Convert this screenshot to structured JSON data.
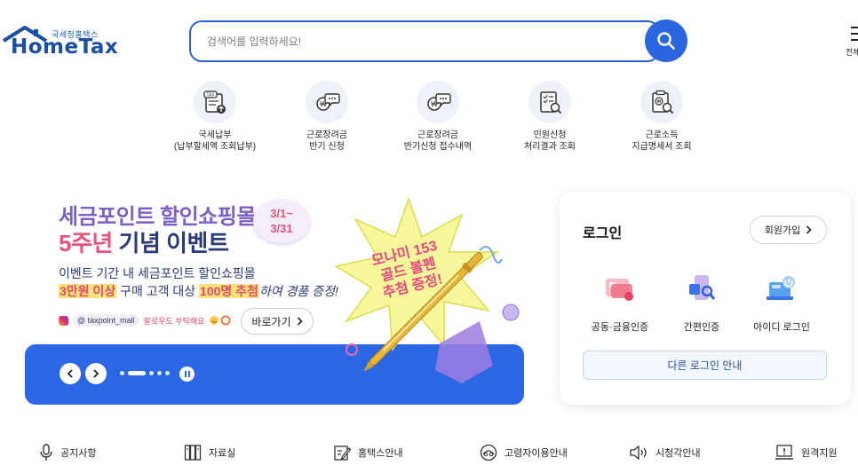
{
  "header": {
    "logo_kr": "국세청홈택스",
    "logo_en": "HomeTax",
    "search_placeholder": "검색어를 입력하세요!",
    "menu_all_label": "전체"
  },
  "quick_links": [
    {
      "line1": "국세납부",
      "line2": "(납부할세액 조회납부)",
      "icon": "tax-payment-icon"
    },
    {
      "line1": "근로장려금",
      "line2": "반기 신청",
      "icon": "incentive-apply-icon"
    },
    {
      "line1": "근로장려금",
      "line2": "반기신청 접수내역",
      "icon": "incentive-history-icon"
    },
    {
      "line1": "민원신청",
      "line2": "처리결과 조회",
      "icon": "civil-result-icon"
    },
    {
      "line1": "근로소득",
      "line2": "지급명세서 조회",
      "icon": "income-statement-icon"
    }
  ],
  "banner": {
    "title1": "세금포인트 할인쇼핑몰",
    "title2_pink": "5주년",
    "title2_rest": " 기념 이벤트",
    "date_line1": "3/1~",
    "date_line2": "3/31",
    "sub1": "이벤트 기간 내 세금포인트 할인쇼핑몰",
    "sub2_hl1": "3만원 이상",
    "sub2_mid": " 구매 고객 대상 ",
    "sub2_hl2": "100명 추첨",
    "sub2_rest": "하여 경품 증정!",
    "insta_handle": "@ taxpoint_mall",
    "insta_note": "팔로우도 부탁해요",
    "go_label": "바로가기",
    "burst_line1": "모나미 153",
    "burst_line2": "골드 볼펜",
    "burst_line3": "추첨 증정!",
    "slides": 5,
    "active_slide": 1,
    "colors": {
      "banner_blue": "#2b66e4",
      "pink": "#e7537a",
      "purple": "#7b5fc7"
    }
  },
  "login": {
    "title": "로그인",
    "join_label": "회원가입",
    "options": [
      {
        "label": "공동·금융인증",
        "icon": "certificate-icon"
      },
      {
        "label": "간편인증",
        "icon": "simple-auth-icon"
      },
      {
        "label": "아이디 로그인",
        "icon": "id-login-icon"
      }
    ],
    "other_label": "다른 로그인 안내"
  },
  "bottom_nav": [
    {
      "label": "공지사항",
      "icon": "microphone-icon"
    },
    {
      "label": "자료실",
      "icon": "archive-icon"
    },
    {
      "label": "홈택스안내",
      "icon": "guide-icon"
    },
    {
      "label": "고령자이용안내",
      "icon": "senior-icon"
    },
    {
      "label": "시청각안내",
      "icon": "speaker-icon"
    },
    {
      "label": "원격지원",
      "icon": "remote-support-icon"
    }
  ]
}
